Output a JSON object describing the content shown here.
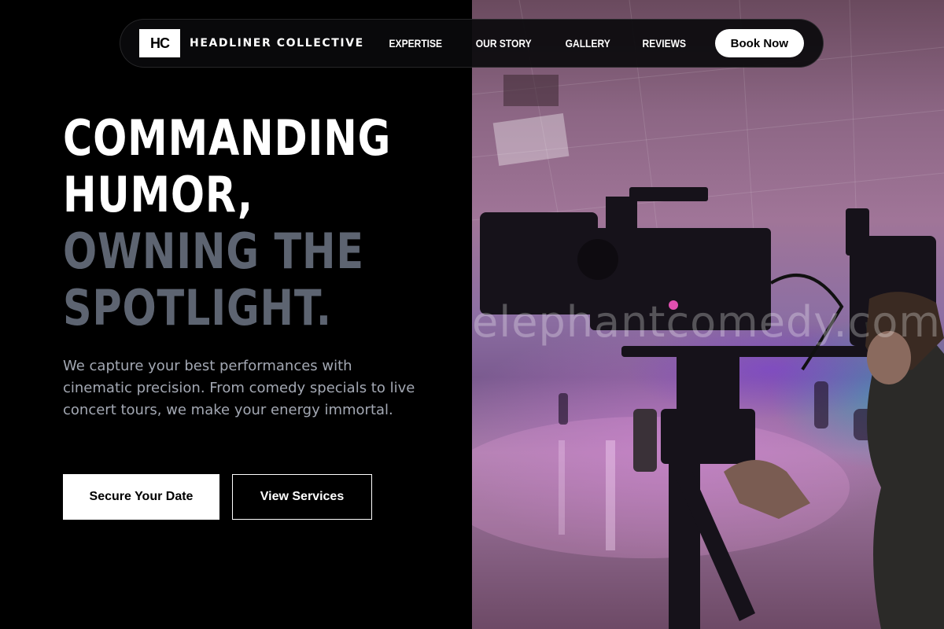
{
  "nav": {
    "logo_text": "HC",
    "brand": "HEADLINER COLLECTIVE",
    "links": [
      "EXPERTISE",
      "OUR STORY",
      "GALLERY",
      "REVIEWS"
    ],
    "cta": "Book Now"
  },
  "hero": {
    "headline_lines": [
      "COMMANDING",
      "HUMOR,",
      "OWNING THE",
      "SPOTLIGHT."
    ],
    "lede": "We capture your best performances with cinematic precision. From comedy specials to live concert tours, we make your energy immortal.",
    "primary_button": "Secure Your Date",
    "secondary_button": "View Services"
  },
  "image": {
    "watermark": "elephantcomedy.com",
    "subject": "camera operator filming on cinema rig in a purple-lit venue"
  },
  "colors": {
    "background": "#000000",
    "headline_white": "#ffffff",
    "headline_grey": "#5d6471",
    "body_text": "#a3a8b3"
  }
}
